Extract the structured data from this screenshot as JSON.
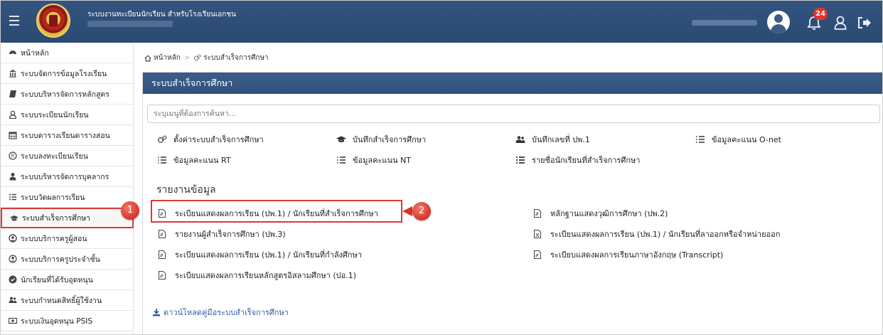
{
  "header": {
    "app_title": "ระบบงานทะเบียนนักเรียน สำหรับโรงเรียนเอกชน",
    "notification_count": "24"
  },
  "sidebar": {
    "items": [
      {
        "label": "หน้าหลัก",
        "icon": "dashboard-icon"
      },
      {
        "label": "ระบบจัดการข้อมูลโรงเรียน",
        "icon": "institution-icon"
      },
      {
        "label": "ระบบบริหารจัดการหลักสูตร",
        "icon": "book-icon"
      },
      {
        "label": "ระบบระเบียนนักเรียน",
        "icon": "user-icon"
      },
      {
        "label": "ระบบตารางเรียนตารางสอน",
        "icon": "calendar-icon"
      },
      {
        "label": "ระบบลงทะเบียนเรียน",
        "icon": "registered-icon"
      },
      {
        "label": "ระบบบริหารจัดการบุคลากร",
        "icon": "person-icon"
      },
      {
        "label": "ระบบวัดผลการเรียน",
        "icon": "list-icon"
      },
      {
        "label": "ระบบสำเร็จการศึกษา",
        "icon": "graduation-cap-icon"
      },
      {
        "label": "ระบบบริการครูผู้สอน",
        "icon": "teacher-icon"
      },
      {
        "label": "ระบบบริการครูประจำชั้น",
        "icon": "user-circle-icon"
      },
      {
        "label": "นักเรียนที่ได้รับอุดหนุน",
        "icon": "check-circle-icon"
      },
      {
        "label": "ระบบกำหนดสิทธิ์ผู้ใช้งาน",
        "icon": "users-icon"
      },
      {
        "label": "ระบบเงินอุดหนุน PSIS",
        "icon": "money-icon"
      }
    ],
    "active_index": 8
  },
  "breadcrumb": {
    "home": "หน้าหลัก",
    "separator": ">",
    "current": "ระบบสำเร็จการศึกษา"
  },
  "panel": {
    "title": "ระบบสำเร็จการศึกษา",
    "search_placeholder": "ระบุเมนูที่ต้องการค้นหา..."
  },
  "menu_items": [
    {
      "label": "ตั้งค่าระบบสำเร็จการศึกษา",
      "icon": "cogs-icon"
    },
    {
      "label": "บันทึกสำเร็จการศึกษา",
      "icon": "graduation-cap-icon"
    },
    {
      "label": "บันทึกเลขที่ ปพ.1",
      "icon": "users-icon"
    },
    {
      "label": "ข้อมูลคะแนน O-net",
      "icon": "list-ol-icon"
    },
    {
      "label": "ข้อมูลคะแนน RT",
      "icon": "list-ol-icon"
    },
    {
      "label": "ข้อมูลคะแนน NT",
      "icon": "list-ol-icon"
    },
    {
      "label": "รายชื่อนักเรียนที่สำเร็จการศึกษา",
      "icon": "list-icon"
    }
  ],
  "reports_section_title": "รายงานข้อมูล",
  "reports": [
    {
      "label": "ระเบียนแสดงผลการเรียน (ปพ.1) / นักเรียนที่สำเร็จการศึกษา",
      "icon": "file-pdf-icon"
    },
    {
      "label": "หลักฐานแสดงวุฒิการศึกษา (ปพ.2)",
      "icon": "file-pdf-icon"
    },
    {
      "label": "รายงานผู้สำเร็จการศึกษา (ปพ.3)",
      "icon": "file-pdf-icon"
    },
    {
      "label": "ระเบียนแสดงผลการเรียน (ปพ.1) / นักเรียนที่ลาออกหรือจำหน่ายออก",
      "icon": "file-excel-icon"
    },
    {
      "label": "ระเบียนแสดงผลการเรียน (ปพ.1) / นักเรียนที่กำลังศึกษา",
      "icon": "file-pdf-icon"
    },
    {
      "label": "ระเบียบแสดงผลการเรียนภาษาอังกฤษ (Transcript)",
      "icon": "file-pdf-icon"
    },
    {
      "label": "ระเบียบแสดงผลการเรียนหลักสูตรอิสลามศึกษา (ปอ.1)",
      "icon": "file-pdf-icon"
    }
  ],
  "download_link": "ดาวน์โหลดคู่มือระบบสำเร็จการศึกษา",
  "step_markers": [
    "1",
    "2"
  ],
  "colors": {
    "header_bg": "#2c4c76",
    "accent_red": "#d93a3a",
    "link_blue": "#2f5fa0"
  }
}
